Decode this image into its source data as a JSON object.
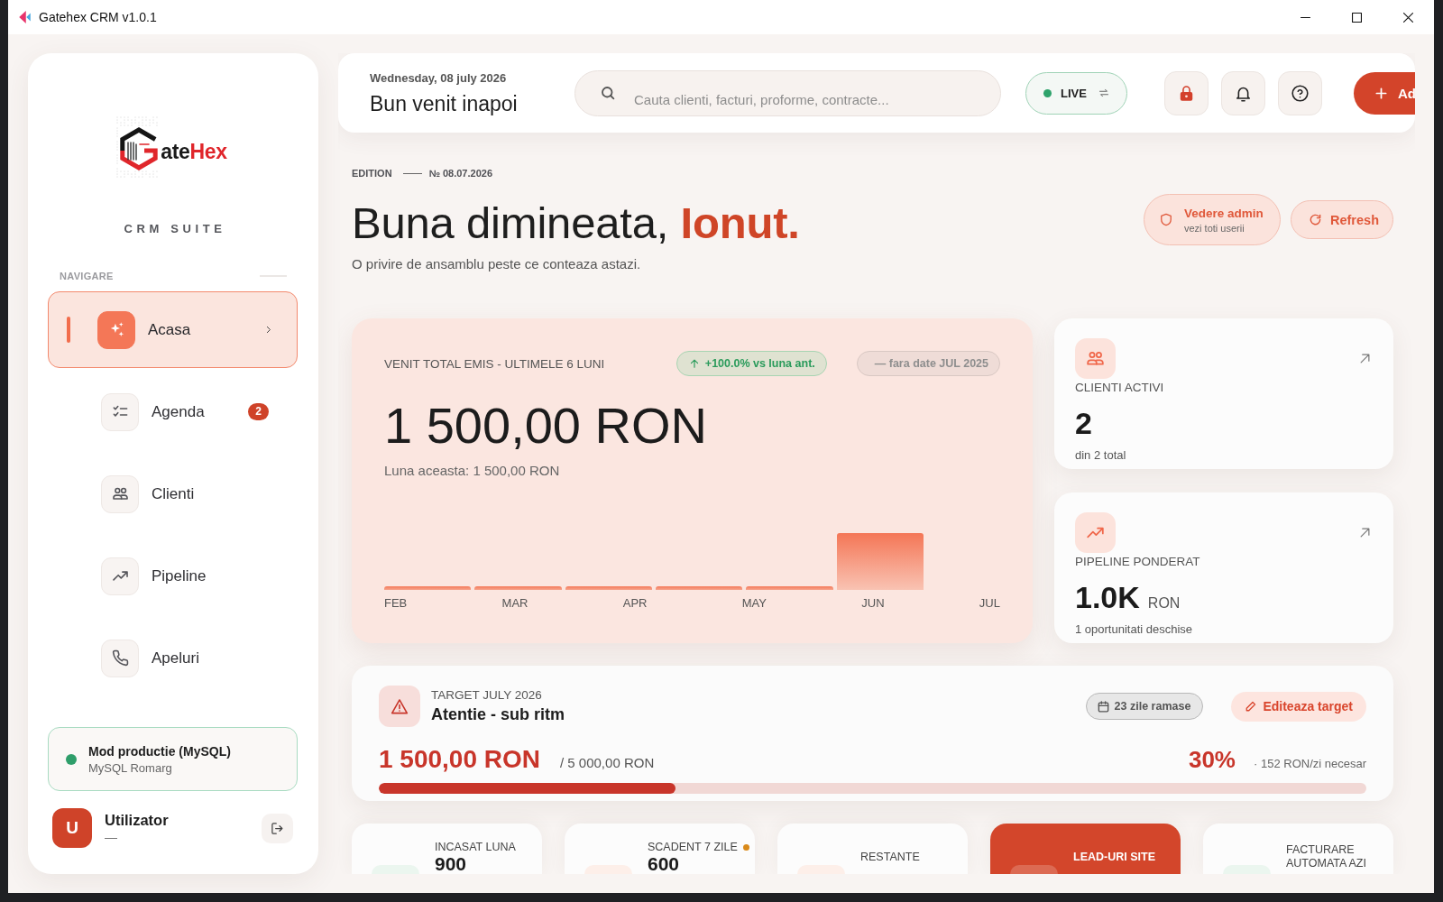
{
  "window": {
    "title": "Gatehex CRM v1.0.1"
  },
  "sidebar": {
    "logo_text": "ate**Hex**",
    "suite_label": "CRM SUITE",
    "nav_heading": "NAVIGARE",
    "nav_items": [
      {
        "kind": "home",
        "label": "Acasa",
        "selected": true
      },
      {
        "kind": "agenda",
        "label": "Agenda",
        "selected": false,
        "badge": "2"
      },
      {
        "kind": "clients",
        "label": "Clienti",
        "selected": false
      },
      {
        "kind": "pipeline",
        "label": "Pipeline",
        "selected": false
      },
      {
        "kind": "calls",
        "label": "Apeluri",
        "selected": false
      }
    ],
    "db_status": {
      "title": "Mod productie (MySQL)",
      "subtitle": "MySQL Romarg",
      "color": "#2e9e6a"
    },
    "user": {
      "initial": "U",
      "name": "Utilizator",
      "role": "—"
    }
  },
  "header": {
    "date": "Wednesday, 08 july 2026",
    "greeting": "Bun venit inapoi",
    "search": {
      "placeholder": "Cauta clienti, facturi, proforme, contracte..."
    },
    "live": {
      "label": "LIVE",
      "on": true
    },
    "add_button": {
      "label": "Ad"
    }
  },
  "page": {
    "edition_label": "EDITION",
    "edition_number": "№ 08.07.2026",
    "title": "Buna dimineata, **Ionut.**",
    "subtitle": "O privire de ansamblu peste ce conteaza astazi.",
    "admin_button": {
      "label": "Vedere admin",
      "sublabel": "vezi toti userii"
    },
    "refresh_button": {
      "label": "Refresh"
    }
  },
  "revenue": {
    "title": "VENIT TOTAL EMIS - ULTIMELE 6 LUNI",
    "change_badge": "+100.0% vs luna ant.",
    "compare_badge": "— fara date JUL 2025",
    "total": "1 500,00 RON",
    "subtitle": "Luna aceasta: 1 500,00 RON",
    "month_labels": [
      "FEB",
      "MAR",
      "APR",
      "MAY",
      "JUN",
      "JUL"
    ]
  },
  "kpi_cards": [
    {
      "kind": "clients",
      "label": "CLIENTI ACTIVI",
      "value": "2",
      "caption": "din 2 total"
    },
    {
      "kind": "pipeline",
      "label": "PIPELINE PONDERAT",
      "value": "1.0K",
      "unit": "RON",
      "caption": "1 oportunitati deschise"
    }
  ],
  "target": {
    "label": "TARGET JULY 2026",
    "status": "Atentie - sub ritm",
    "days_badge": "23 zile ramase",
    "edit_button": "Editeaza target",
    "achieved": "1 500,00 RON",
    "goal": "/ 5 000,00 RON",
    "percent": "30%",
    "daily_needed": "· 152 RON/zi necesar",
    "progress": {
      "level": 0.3
    }
  },
  "stat_cards": [
    {
      "kind": "income",
      "label": "INCASAT LUNA",
      "value": "900"
    },
    {
      "kind": "due",
      "label": "SCADENT 7 ZILE",
      "value": "600",
      "color": "#d98a1a"
    },
    {
      "kind": "overdue",
      "label": "RESTANTE"
    },
    {
      "kind": "leads",
      "label": "LEAD-URI SITE"
    },
    {
      "kind": "automation",
      "label": "FACTURARE AUTOMATA AZI"
    }
  ]
}
